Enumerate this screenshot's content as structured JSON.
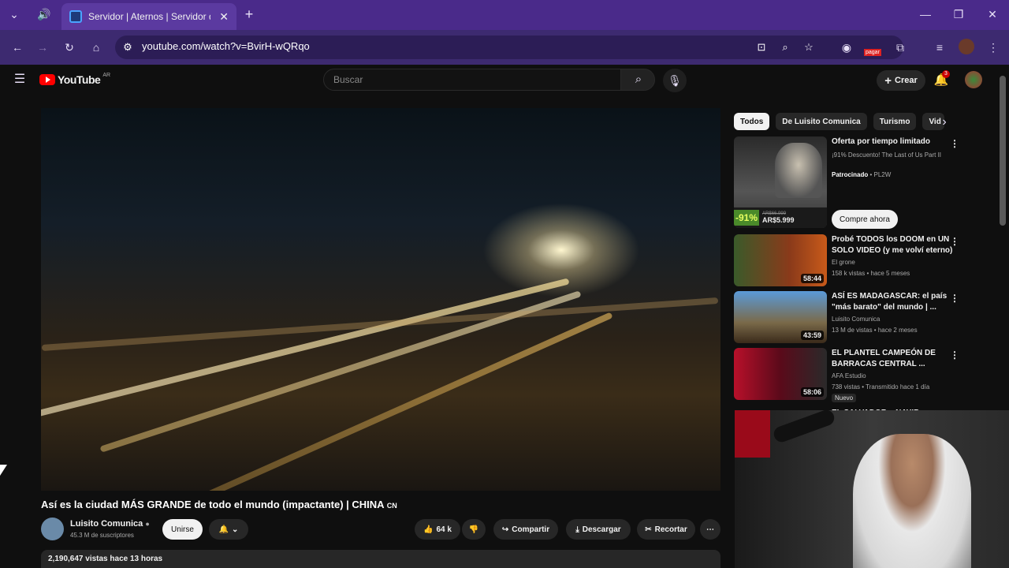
{
  "browser": {
    "tab_title": "Servidor | Aternos | Servidor de",
    "url": "youtube.com/watch?v=BvirH-wQRqo",
    "extension_badge": "pagar"
  },
  "youtube": {
    "logo_text": "YouTube",
    "region": "AR",
    "search_placeholder": "Buscar",
    "create_label": "Crear",
    "notifications_count": "3"
  },
  "video": {
    "title": "Así es la ciudad MÁS GRANDE de todo el mundo (impactante) | CHINA",
    "title_flag": "CN",
    "channel": "Luisito Comunica",
    "subscribers": "45.3 M de suscriptores",
    "join_label": "Unirse",
    "likes": "64 k",
    "share_label": "Compartir",
    "download_label": "Descargar",
    "clip_label": "Recortar",
    "views": "2,190,647 vistas",
    "published": "hace 13 horas"
  },
  "chips": [
    "Todos",
    "De Luisito Comunica",
    "Turismo",
    "Vid"
  ],
  "ad": {
    "title": "Oferta por tiempo limitado",
    "description": "¡91% Descuento! The Last of Us Part II",
    "sponsored": "Patrocinado",
    "advertiser": "PL2W",
    "cta": "Compre ahora",
    "discount": "-91%",
    "old_price": "AR$66.999",
    "price": "AR$5.999"
  },
  "recommendations": [
    {
      "title": "Probé TODOS los DOOM en UN SOLO VIDEO (y me volví eterno)",
      "channel": "El grone",
      "meta": "158 k vistas • hace 5 meses",
      "duration": "58:44"
    },
    {
      "title": "ASÍ ES MADAGASCAR: el país \"más barato\" del mundo | ...",
      "channel": "Luisito Comunica",
      "meta": "13 M de vistas • hace 2 meses",
      "duration": "43:59"
    },
    {
      "title": "EL PLANTEL CAMPEÓN DE BARRACAS CENTRAL ...",
      "channel": "AFA Estudio",
      "meta": "738 vistas • Transmitido hace 1 día",
      "duration": "58:06",
      "badge": "Nuevo"
    },
    {
      "title": "EL SALVADOR y NAYIB BUKELE:",
      "channel": "",
      "meta": "",
      "duration": ""
    }
  ]
}
